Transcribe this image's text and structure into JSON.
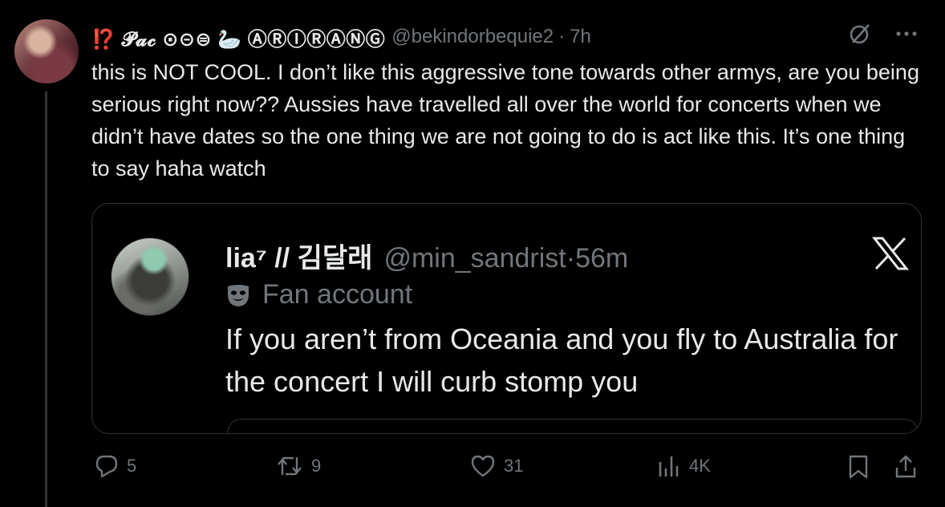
{
  "tweet": {
    "display_name_prefix": "⁉️",
    "display_name": "𝓟𝓪𝓬 ⊙⊝⊜ 🦢 ⒶⓇⒾⓇⒶⓃⒼ",
    "handle": "@bekindorbequie2",
    "separator": "·",
    "time": "7h",
    "text": "this is NOT COOL. I don’t like this aggressive tone towards other armys, are you being serious right now?? Aussies have travelled all over the world for concerts when we didn’t have dates so the one thing we are not going to do is act like this. It’s one thing to say haha watch"
  },
  "quote": {
    "display_name": "lia⁷ // 김달래",
    "handle": "@min_sandrist",
    "separator": "·",
    "time": "56m",
    "label": "Fan account",
    "text": "If you aren’t from Oceania and you fly to Australia for the concert I will curb stomp you"
  },
  "actions": {
    "replies": "5",
    "reposts": "9",
    "likes": "31",
    "views": "4K"
  },
  "colors": {
    "background": "#000000",
    "text": "#e7e9ea",
    "muted": "#71767b",
    "border": "#2f3336"
  },
  "icons": [
    "grok-icon",
    "more-icon",
    "x-logo-icon",
    "mask-icon",
    "reply-icon",
    "repost-icon",
    "like-icon",
    "views-icon",
    "bookmark-icon",
    "share-icon"
  ]
}
